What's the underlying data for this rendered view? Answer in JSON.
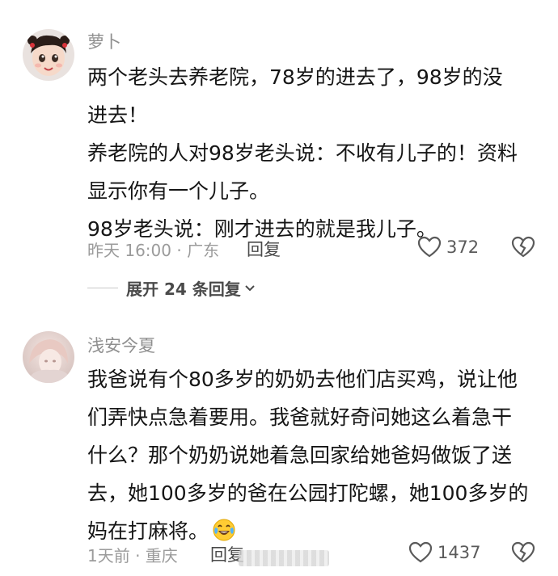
{
  "comments": [
    {
      "username": "萝卜",
      "lines": [
        "两个老头去养老院，78岁的进去了，98岁的没",
        "进去！",
        "养老院的人对98岁老头说：不收有儿子的！资料",
        "显示你有一个儿子。",
        "98岁老头说：刚才进去的就是我儿子。"
      ],
      "meta": "昨天 16:00 · 广东",
      "reply_label": "回复",
      "likes": "372",
      "expand_label": "展开 24 条回复"
    },
    {
      "username": "浅安今夏",
      "lines": [
        "我爸说有个80多岁的奶奶去他们店买鸡，说让他",
        "们弄快点急着要用。我爸就好奇问她这么着急干",
        "什么？那个奶奶说她着急回家给她爸妈做饭了送",
        "去，她100多岁的爸在公园打陀螺，她100多岁的",
        "妈在打麻将。"
      ],
      "meta": "1天前 · 重庆",
      "reply_label": "回复",
      "likes": "1437"
    }
  ],
  "icons": {
    "like": "heart-outline-icon",
    "dislike": "broken-heart-icon",
    "expand": "chevron-down-icon",
    "emoji": "laughing-crying-emoji-icon"
  },
  "colors": {
    "text": "#151515",
    "muted": "#9b9b9b",
    "icon": "#5a5a5a"
  }
}
